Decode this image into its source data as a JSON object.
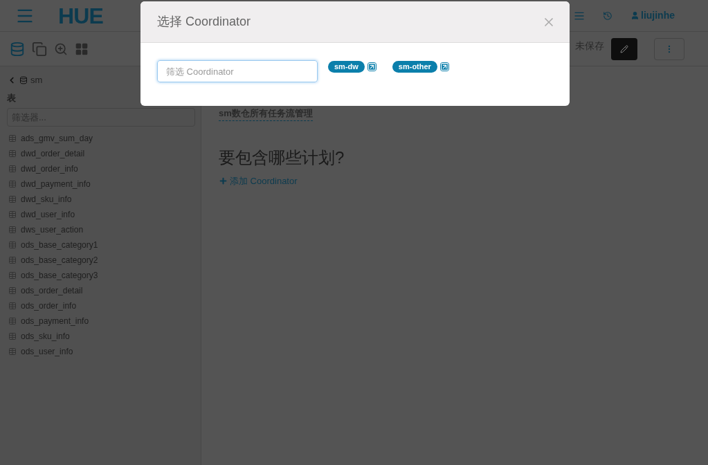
{
  "topbar": {
    "logo": "HUE",
    "user": "liujinhe"
  },
  "toolbar": {
    "status": "未保存"
  },
  "sidebar": {
    "database": "sm",
    "section": "表",
    "filter_placeholder": "筛选器...",
    "tables": [
      "ads_gmv_sum_day",
      "dwd_order_detail",
      "dwd_order_info",
      "dwd_payment_info",
      "dwd_sku_info",
      "dwd_user_info",
      "dws_user_action",
      "ods_base_category1",
      "ods_base_category2",
      "ods_base_category3",
      "ods_order_detail",
      "ods_order_info",
      "ods_payment_info",
      "ods_sku_info",
      "ods_user_info"
    ]
  },
  "main": {
    "description": "sm数仓所有任务流管理",
    "heading": "要包含哪些计划?",
    "add_link": "添加 Coordinator"
  },
  "modal": {
    "title": "选择 Coordinator",
    "filter_placeholder": "筛选 Coordinator",
    "items": [
      {
        "name": "sm-dw"
      },
      {
        "name": "sm-other"
      }
    ]
  }
}
